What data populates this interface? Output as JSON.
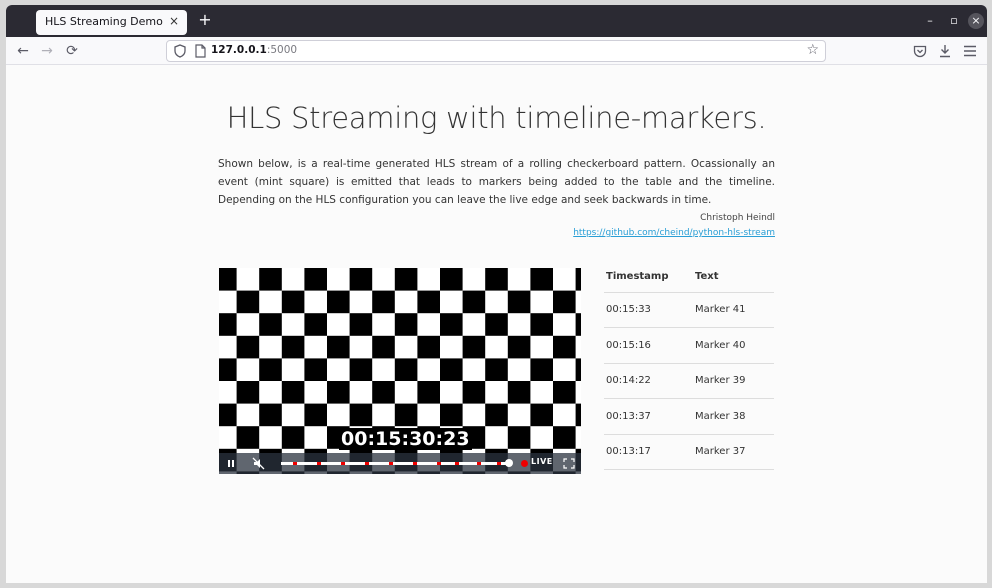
{
  "browser": {
    "tab_title": "HLS Streaming Demo",
    "tab_close": "×",
    "new_tab": "+",
    "url_host": "127.0.0.1",
    "url_port": ":5000",
    "window_controls": {
      "minimize": "–",
      "maximize": "▫",
      "close": "×"
    },
    "nav": {
      "back": "←",
      "forward": "→",
      "reload": "⟳"
    },
    "toolbar_icons": [
      "bookmark-star-icon",
      "pocket-icon",
      "downloads-icon",
      "menu-icon"
    ]
  },
  "page": {
    "heading": "HLS Streaming with timeline-markers.",
    "intro": "Shown below, is a real-time generated HLS stream of a rolling checkerboard pattern. Ocassionally an event (mint square) is emitted that leads to markers being added to the table and the timeline. Depending on the HLS configuration you can leave the live edge and seek backwards in time.",
    "author": "Christoph Heindl",
    "author_link": "https://github.com/cheind/python-hls-stream"
  },
  "player": {
    "time_overlay": "00:15:30:23",
    "live_label": "LIVE",
    "progress": 1.0,
    "colors": {
      "control_bar": "#2b333f",
      "marker": "#e00000"
    }
  },
  "markers_table": {
    "headers": [
      "Timestamp",
      "Text"
    ],
    "rows": [
      [
        "00:15:33",
        "Marker 41"
      ],
      [
        "00:15:16",
        "Marker 40"
      ],
      [
        "00:14:22",
        "Marker 39"
      ],
      [
        "00:13:37",
        "Marker 38"
      ],
      [
        "00:13:17",
        "Marker 37"
      ]
    ]
  }
}
